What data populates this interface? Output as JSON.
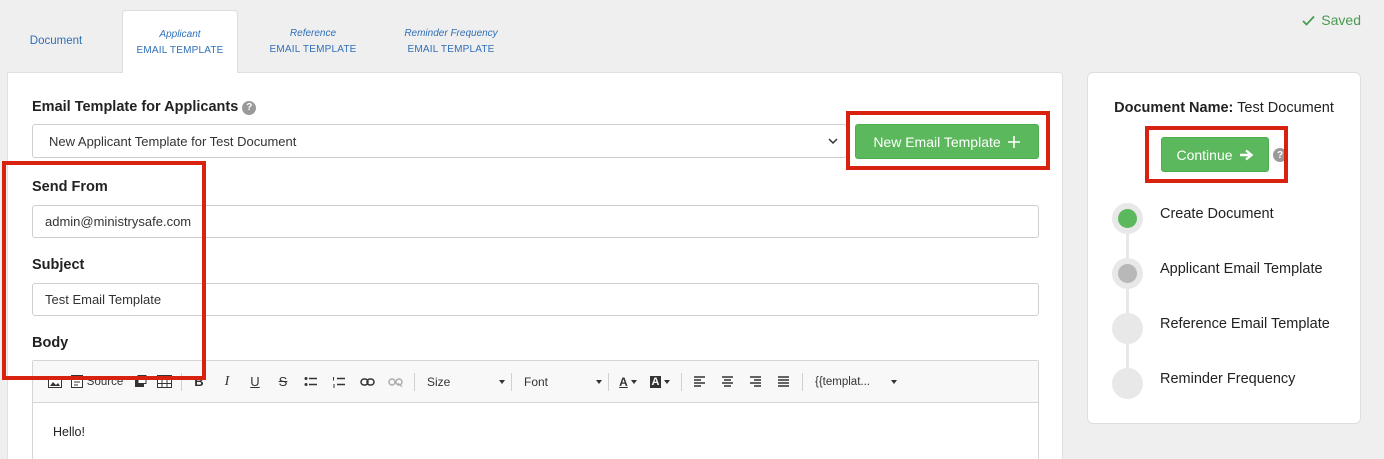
{
  "tabs": [
    {
      "sub": "",
      "main": "Document"
    },
    {
      "sub": "Applicant",
      "main": "EMAIL TEMPLATE"
    },
    {
      "sub": "Reference",
      "main": "EMAIL TEMPLATE"
    },
    {
      "sub": "Reminder Frequency",
      "main": "EMAIL TEMPLATE"
    }
  ],
  "status": {
    "saved": "Saved"
  },
  "form": {
    "template_label": "Email Template for Applicants",
    "template_selected": "New Applicant Template for Test Document",
    "new_template_button": "New Email Template",
    "send_from_label": "Send From",
    "send_from_value": "admin@ministrysafe.com",
    "subject_label": "Subject",
    "subject_value": "Test Email Template",
    "body_label": "Body"
  },
  "editor": {
    "toolbar": {
      "source": "Source",
      "size": "Size",
      "font": "Font",
      "template": "{{templat..."
    },
    "body_text": "Hello!"
  },
  "sidebar": {
    "doc_name_label": "Document Name:",
    "doc_name_value": "Test Document",
    "continue_button": "Continue",
    "steps": [
      {
        "label": "Create Document",
        "state": "complete"
      },
      {
        "label": "Applicant Email Template",
        "state": "current"
      },
      {
        "label": "Reference Email Template",
        "state": "pending"
      },
      {
        "label": "Reminder Frequency",
        "state": "pending"
      }
    ]
  },
  "colors": {
    "accent_blue": "#2f6fb7",
    "success_green": "#5cb85c",
    "annotation_red": "#d8220f",
    "step_complete": "#5cb85c",
    "step_current": "#b8b8b8"
  }
}
